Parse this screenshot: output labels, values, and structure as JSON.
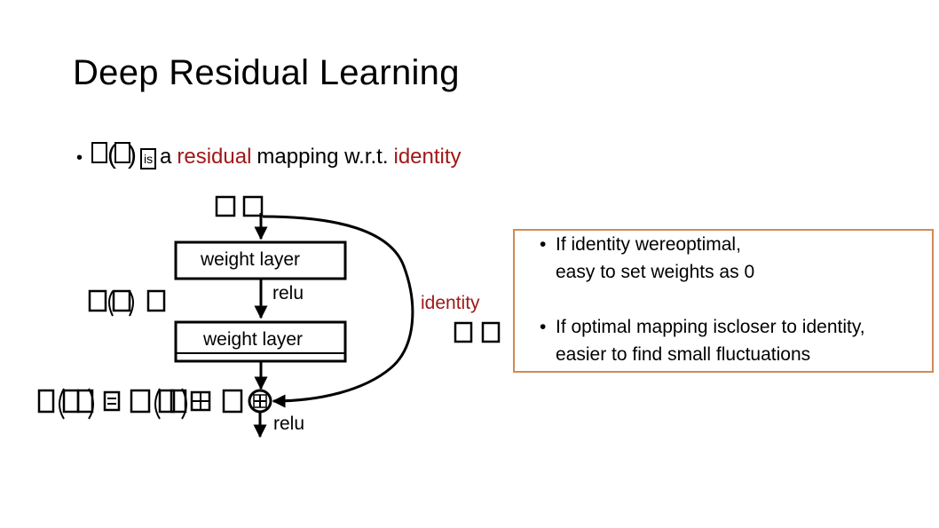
{
  "slide": {
    "title": "Deep Residual Learning",
    "bullet": {
      "bullet_char": "•",
      "tofu_glyph": "",
      "paren_open": "(",
      "paren_close": ")",
      "is_glyph": "is",
      "text_a": "a",
      "highlight_residual": "residual",
      "text_mapping": "mapping w.r.t.",
      "highlight_identity": "identity"
    },
    "colors": {
      "accent_red": "#a01818",
      "callout_border": "#cf8b55",
      "line": "#000000"
    }
  },
  "diagram": {
    "input_label": "x (unrendered glyphs)",
    "layer1_label": "weight layer",
    "relu1_label": "relu",
    "fx_label": "F(x) (unrendered glyphs)",
    "layer2_label": "weight layer",
    "output_equation": "H(x) = F(x) + x (unrendered glyphs)",
    "plus_symbol": "+",
    "relu2_label": "relu",
    "identity_label": "identity",
    "identity_x_label": "x (unrendered glyphs)"
  },
  "callout": {
    "bullets": [
      {
        "line1": "If identity wereoptimal,",
        "line2": "easy to set weights as 0"
      },
      {
        "line1": "If optimal mapping iscloser to identity,",
        "line2": "easier to find small fluctuations"
      }
    ],
    "bullet_char": "•"
  }
}
